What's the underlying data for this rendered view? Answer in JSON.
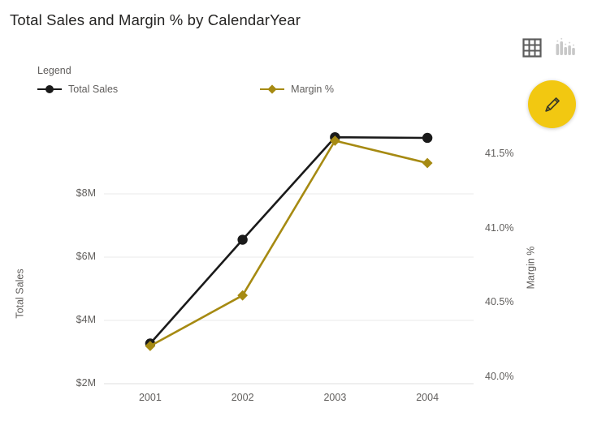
{
  "header": {
    "title": "Total Sales and Margin % by CalendarYear",
    "icons": [
      {
        "name": "table-grid-icon",
        "label": "Show as a table"
      },
      {
        "name": "bar-chart-icon",
        "label": "Focus mode"
      }
    ],
    "edit_button": {
      "name": "pencil-edit-icon",
      "label": "Edit"
    }
  },
  "legend": {
    "title": "Legend",
    "items": [
      {
        "label": "Total Sales",
        "color": "#1a1a1a",
        "marker": "circle"
      },
      {
        "label": "Margin %",
        "color": "#a68a12",
        "marker": "diamond"
      }
    ]
  },
  "colors": {
    "total_sales": "#1a1a1a",
    "margin": "#a68a12",
    "accent": "#f2c811",
    "gridline": "#eaeaea",
    "text": "#605e5c",
    "title_text": "#252423"
  },
  "chart_data": {
    "type": "line",
    "title": "Total Sales and Margin % by CalendarYear",
    "xlabel": "",
    "categories": [
      "2001",
      "2002",
      "2003",
      "2004"
    ],
    "grid": true,
    "legend_position": "top-left",
    "series": [
      {
        "name": "Total Sales",
        "axis": "left",
        "color": "#1a1a1a",
        "marker": "circle",
        "values": [
          3.27,
          6.55,
          9.79,
          9.77
        ],
        "value_labels": [
          "$3.27M",
          "$6.55M",
          "$9.79M",
          "$9.77M"
        ]
      },
      {
        "name": "Margin %",
        "axis": "right",
        "color": "#a68a12",
        "marker": "diamond",
        "values": [
          40.21,
          40.55,
          41.59,
          41.44
        ],
        "value_labels": [
          "40.21%",
          "40.55%",
          "41.59%",
          "41.44%"
        ]
      }
    ],
    "y_left": {
      "label": "Total Sales",
      "ticks": [
        "$2M",
        "$4M",
        "$6M",
        "$8M"
      ],
      "tick_values": [
        2,
        4,
        6,
        8
      ],
      "ylim": [
        2,
        8
      ]
    },
    "y_right": {
      "label": "Margin %",
      "ticks": [
        "40.0%",
        "40.5%",
        "41.0%",
        "41.5%"
      ],
      "tick_values": [
        40.0,
        40.5,
        41.0,
        41.5
      ],
      "ylim": [
        40.0,
        41.5
      ]
    }
  }
}
